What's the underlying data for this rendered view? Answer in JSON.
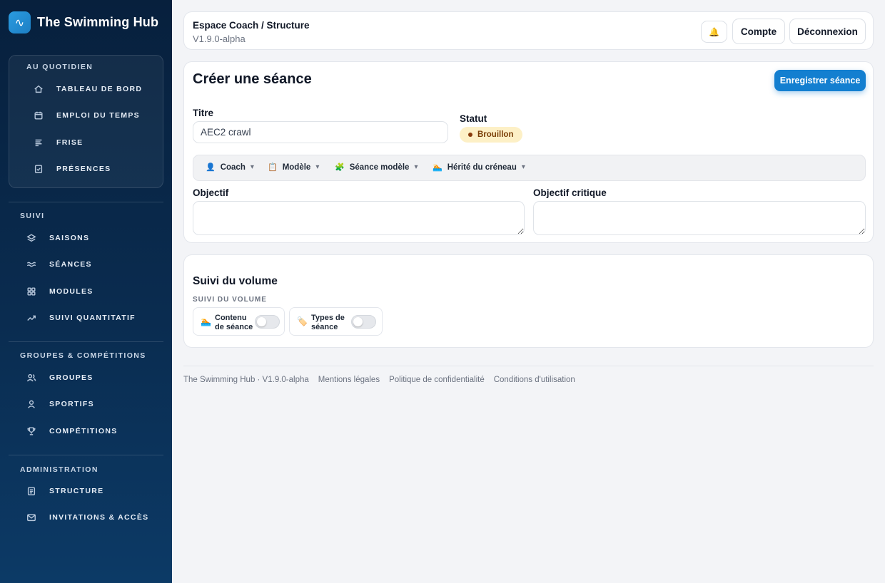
{
  "brand": {
    "name": "The Swimming Hub",
    "logo_icon": "wave-icon",
    "logo_glyph": "∿"
  },
  "sidebar": {
    "sections": [
      {
        "title": "AU QUOTIDIEN",
        "items": [
          {
            "label": "TABLEAU DE BORD",
            "icon": "home-icon"
          },
          {
            "label": "EMPLOI DU TEMPS",
            "icon": "calendar-icon"
          },
          {
            "label": "FRISE",
            "icon": "timeline-icon"
          },
          {
            "label": "PRÉSENCES",
            "icon": "checklist-icon"
          }
        ]
      },
      {
        "title": "SUIVI",
        "items": [
          {
            "label": "SAISONS",
            "icon": "layers-icon"
          },
          {
            "label": "SÉANCES",
            "icon": "waves-icon"
          },
          {
            "label": "MODULES",
            "icon": "grid-icon"
          },
          {
            "label": "SUIVI QUANTITATIF",
            "icon": "trend-icon"
          }
        ]
      },
      {
        "title": "GROUPES & COMPÉTITIONS",
        "items": [
          {
            "label": "GROUPES",
            "icon": "users-icon"
          },
          {
            "label": "SPORTIFS",
            "icon": "user-icon"
          },
          {
            "label": "COMPÉTITIONS",
            "icon": "trophy-icon"
          }
        ]
      },
      {
        "title": "ADMINISTRATION",
        "items": [
          {
            "label": "STRUCTURE",
            "icon": "document-icon"
          },
          {
            "label": "INVITATIONS & ACCÈS",
            "icon": "mail-icon"
          }
        ]
      }
    ]
  },
  "header": {
    "breadcrumb": "Espace Coach / Structure",
    "version": "V1.9.0-alpha",
    "bell_glyph": "🔔",
    "account_label": "Compte",
    "logout_label": "Déconnexion"
  },
  "session_form": {
    "title": "Créer une séance",
    "save_label": "Enregistrer séance",
    "title_label": "Titre",
    "title_value": "AEC2 crawl",
    "status_label": "Statut",
    "status_value": "Brouillon",
    "meta": [
      {
        "label": "Coach",
        "glyph": "👤",
        "icon": "person-icon"
      },
      {
        "label": "Modèle",
        "glyph": "📋",
        "icon": "template-icon"
      },
      {
        "label": "Séance modèle",
        "glyph": "🧩",
        "icon": "puzzle-icon"
      },
      {
        "label": "Hérité du créneau",
        "glyph": "🏊",
        "icon": "swimmer-icon"
      }
    ],
    "caret": "▾",
    "objective_label": "Objectif",
    "objective_value": "",
    "critical_objective_label": "Objectif critique",
    "critical_objective_value": ""
  },
  "volume": {
    "title": "Suivi du volume",
    "subtitle": "SUIVI DU VOLUME",
    "toggles": [
      {
        "label": "Contenu de séance",
        "glyph": "🏊",
        "icon": "swimmer-icon",
        "on": false
      },
      {
        "label": "Types de séance",
        "glyph": "🏷️",
        "icon": "tag-icon",
        "on": false
      }
    ]
  },
  "footer": {
    "app": "The Swimming Hub · V1.9.0-alpha",
    "links": [
      "Mentions légales",
      "Politique de confidentialité",
      "Conditions d'utilisation"
    ]
  },
  "colors": {
    "accent": "#137fd0",
    "sidebar_bg": "#07203d",
    "badge_bg": "#fdf0c6",
    "badge_text": "#7a3e07"
  }
}
